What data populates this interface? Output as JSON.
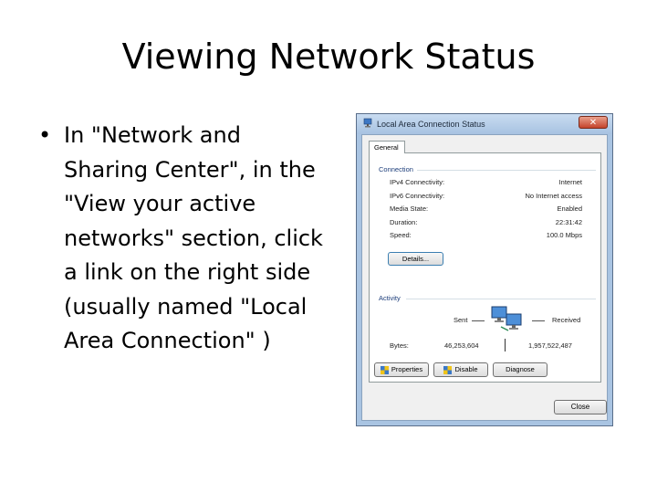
{
  "slide": {
    "title": "Viewing Network Status",
    "bullet_marker": "•",
    "bullet_text": "In \"Network and Sharing Center\", in the \"View your active networks\" section, click a link on the right side (usually named \"Local Area Connection\" )"
  },
  "dialog": {
    "title": "Local Area Connection Status",
    "close_glyph": "✕",
    "tab_general": "General",
    "connection_group": "Connection",
    "rows": [
      {
        "label": "IPv4 Connectivity:",
        "value": "Internet"
      },
      {
        "label": "IPv6 Connectivity:",
        "value": "No Internet access"
      },
      {
        "label": "Media State:",
        "value": "Enabled"
      },
      {
        "label": "Duration:",
        "value": "22:31:42"
      },
      {
        "label": "Speed:",
        "value": "100.0 Mbps"
      }
    ],
    "details_button": "Details...",
    "activity_group": "Activity",
    "sent_label": "Sent",
    "received_label": "Received",
    "bytes_label": "Bytes:",
    "bytes_sent": "46,253,604",
    "bytes_received": "1,957,522,487",
    "properties_button": "Properties",
    "disable_button": "Disable",
    "diagnose_button": "Diagnose",
    "close_button": "Close"
  },
  "icons": [
    "network-icon",
    "shield-icon",
    "computers-icon"
  ]
}
